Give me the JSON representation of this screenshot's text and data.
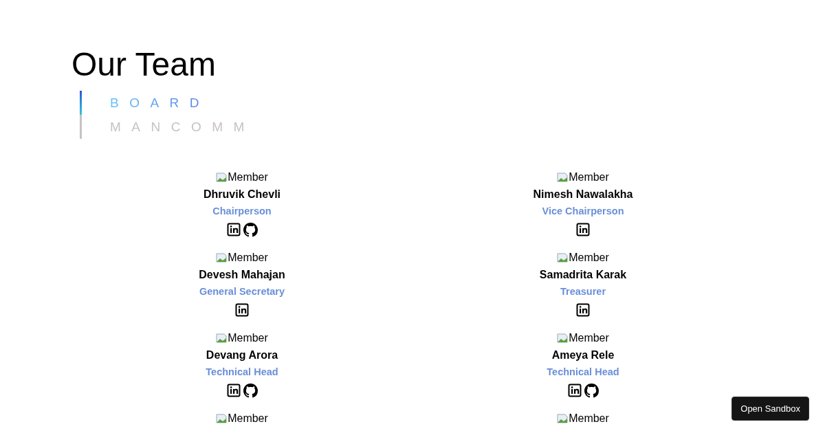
{
  "title": "Our Team",
  "tabs": [
    {
      "label": "BOARD",
      "selected": true
    },
    {
      "label": "MANCOMM",
      "selected": false
    }
  ],
  "members": [
    {
      "image_alt": "Member",
      "name": "Dhruvik Chevli",
      "role": "Chairperson",
      "links": [
        {
          "kind": "linkedin"
        },
        {
          "kind": "github"
        }
      ]
    },
    {
      "image_alt": "Member",
      "name": "Nimesh Nawalakha",
      "role": "Vice Chairperson",
      "links": [
        {
          "kind": "linkedin"
        }
      ]
    },
    {
      "image_alt": "Member",
      "name": "Devesh Mahajan",
      "role": "General Secretary",
      "links": [
        {
          "kind": "linkedin"
        }
      ]
    },
    {
      "image_alt": "Member",
      "name": "Samadrita Karak",
      "role": "Treasurer",
      "links": [
        {
          "kind": "linkedin"
        }
      ]
    },
    {
      "image_alt": "Member",
      "name": "Devang Arora",
      "role": "Technical Head",
      "links": [
        {
          "kind": "linkedin"
        },
        {
          "kind": "github"
        }
      ]
    },
    {
      "image_alt": "Member",
      "name": "Ameya Rele",
      "role": "Technical Head",
      "links": [
        {
          "kind": "linkedin"
        },
        {
          "kind": "github"
        }
      ]
    },
    {
      "image_alt": "Member"
    },
    {
      "image_alt": "Member"
    }
  ],
  "sandbox_button": "Open Sandbox"
}
